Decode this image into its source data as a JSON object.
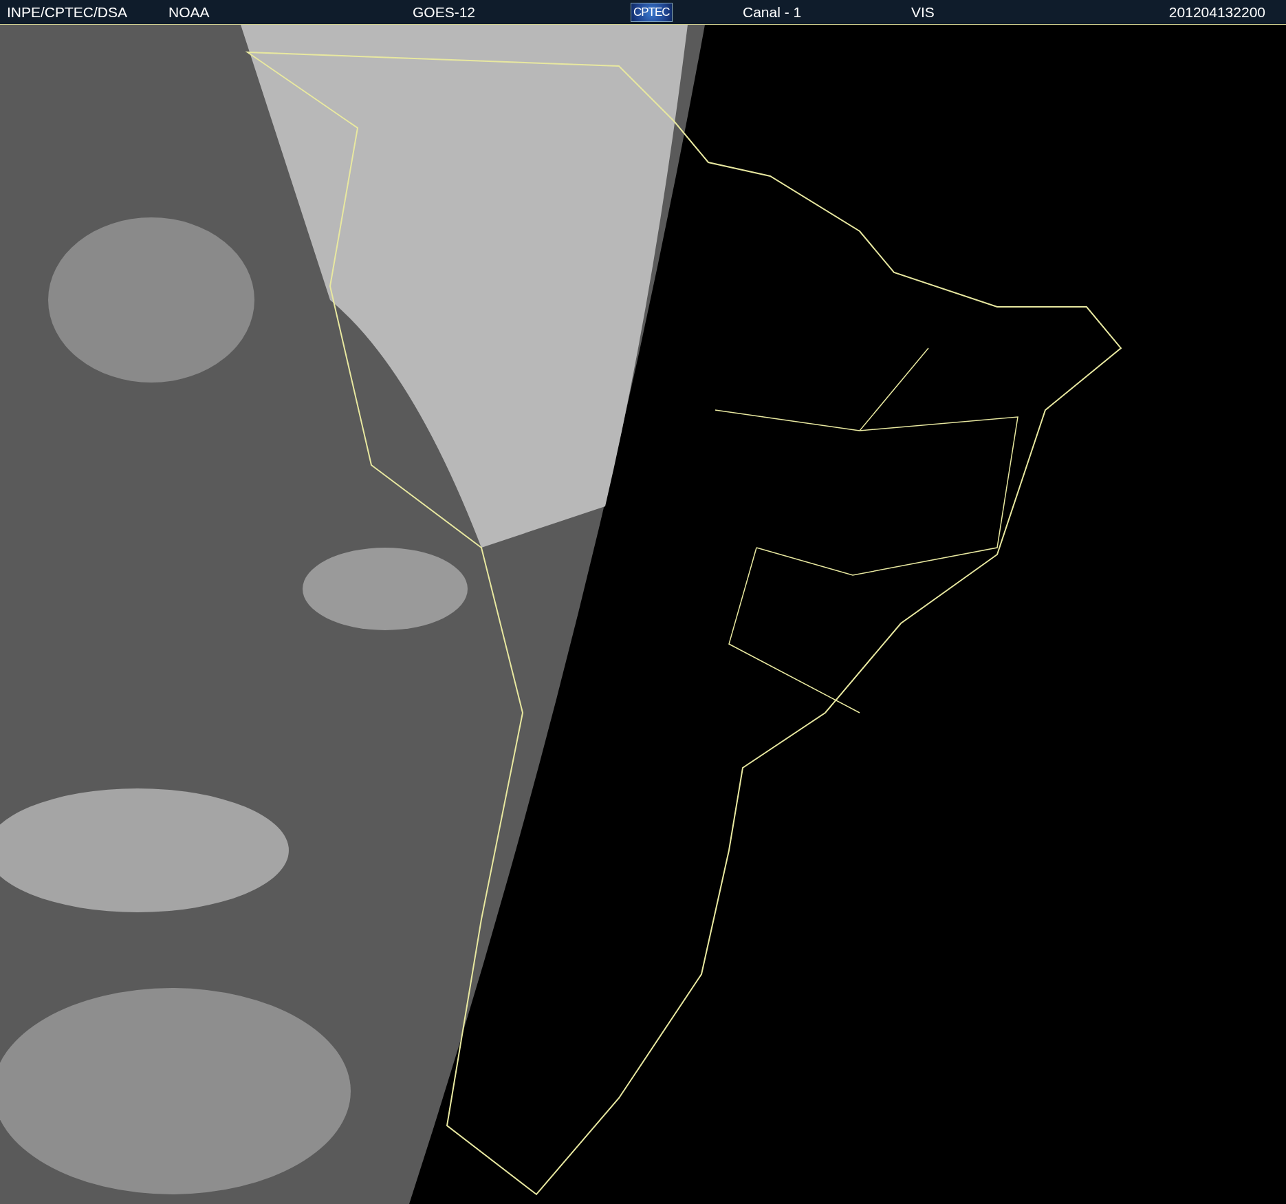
{
  "header": {
    "source": "INPE/CPTEC/DSA",
    "agency": "NOAA",
    "satellite": "GOES-12",
    "logo": "CPTEC",
    "channel": "Canal - 1",
    "band": "VIS",
    "timestamp": "201204132200"
  }
}
